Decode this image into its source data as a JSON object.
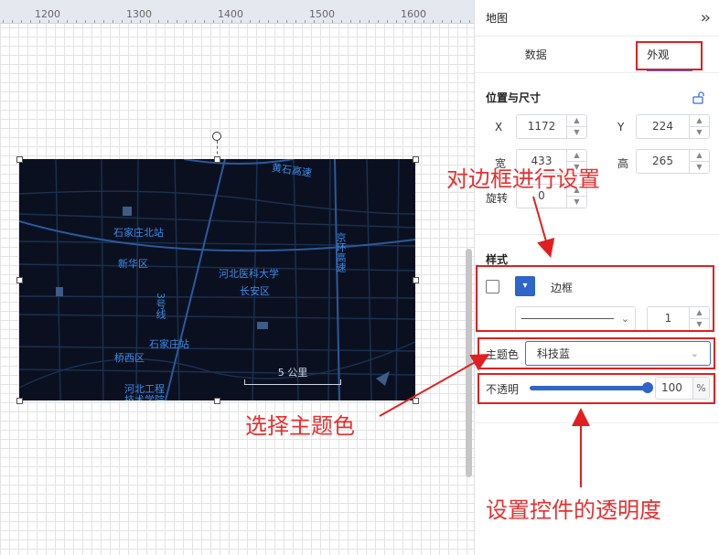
{
  "ruler": {
    "labels": [
      "1200",
      "1300",
      "1400",
      "1500",
      "1600"
    ]
  },
  "map": {
    "labels": [
      {
        "key": "shijiazhuang_north",
        "text": "石家庄北站"
      },
      {
        "key": "xinhua",
        "text": "新华区"
      },
      {
        "key": "hebei_medical",
        "text": "河北医科大学"
      },
      {
        "key": "changan",
        "text": "长安区"
      },
      {
        "key": "line3",
        "text": "3号线"
      },
      {
        "key": "shijiazhuang_station",
        "text": "石家庄站"
      },
      {
        "key": "qiaoxi",
        "text": "桥西区"
      },
      {
        "key": "hebei_eng",
        "text": "河北工程技术学院"
      },
      {
        "key": "huangshi",
        "text": "黄石高速"
      },
      {
        "key": "jinghuan",
        "text": "京环高速"
      }
    ],
    "scale_text": "5 公里"
  },
  "panel": {
    "title": "地图",
    "collapse_icon": "double-chevron-right-icon",
    "tabs": [
      {
        "label": "数据",
        "active": false
      },
      {
        "label": "外观",
        "active": true
      }
    ],
    "position_size": {
      "title": "位置与尺寸",
      "lock_icon": "unlock-icon",
      "x_label": "X",
      "x_value": "1172",
      "y_label": "Y",
      "y_value": "224",
      "width_label": "宽",
      "width_value": "433",
      "height_label": "高",
      "height_value": "265",
      "rotate_label": "旋转",
      "rotate_value": "0"
    },
    "style": {
      "title": "样式",
      "border_label": "边框",
      "border_checked": false,
      "border_color": "#2f64c8",
      "border_width": "1",
      "theme_label": "主题色",
      "theme_value": "科技蓝",
      "opacity_label": "不透明",
      "opacity_value": "100",
      "opacity_unit": "%"
    }
  },
  "annotations": {
    "border": "对边框进行设置",
    "theme": "选择主题色",
    "opacity": "设置控件的透明度"
  },
  "colors": {
    "accent": "#2f64c8",
    "annotation": "#e02020",
    "map_bg": "#0b1020"
  }
}
